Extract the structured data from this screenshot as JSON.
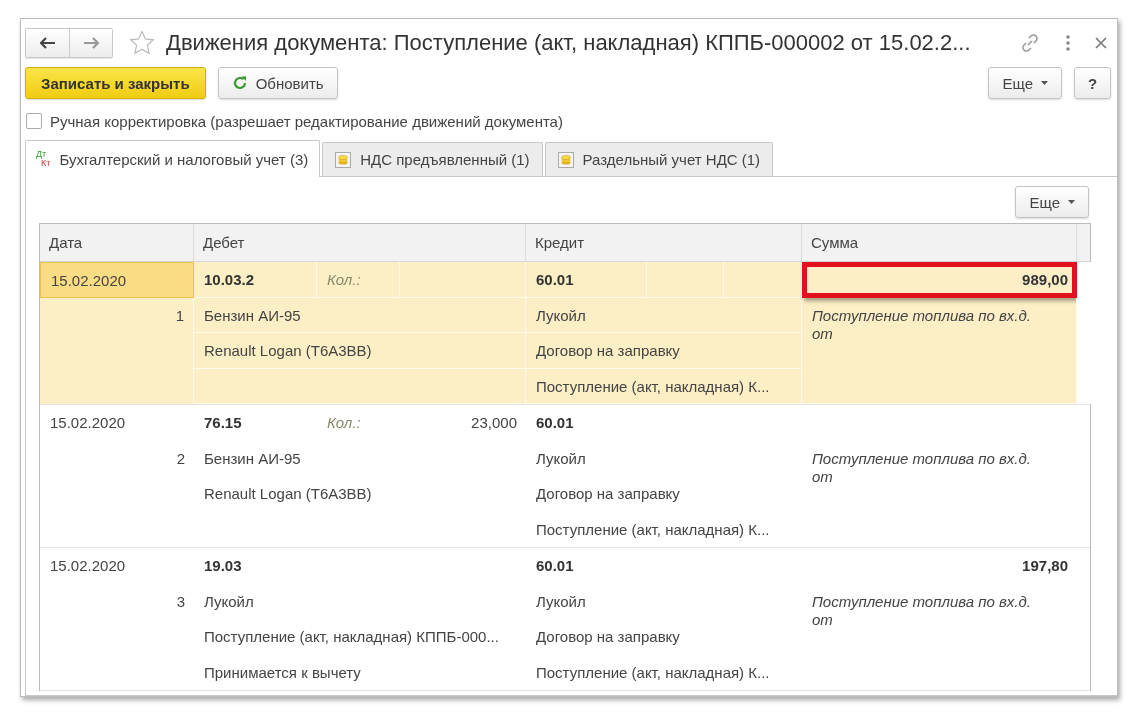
{
  "window": {
    "title": "Движения документа: Поступление (акт, накладная) КППБ-000002 от 15.02.2...",
    "favorite": false
  },
  "toolbar": [
    {
      "kind": "primary",
      "label": "Записать и закрыть"
    },
    {
      "kind": "refresh",
      "label": "Обновить"
    },
    {
      "kind": "menu",
      "label": "Еще"
    },
    {
      "kind": "help",
      "label": "?"
    }
  ],
  "manual_edit": {
    "label": "Ручная корректировка (разрешает редактирование движений документа)",
    "checked": false
  },
  "tabs": [
    {
      "kind": "accounts",
      "icon_top": "Дт",
      "icon_bottom": "Кт",
      "label": "Бухгалтерский и налоговый учет (3)",
      "selected": true
    },
    {
      "kind": "register",
      "label": "НДС предъявленный (1)",
      "selected": false
    },
    {
      "kind": "register",
      "label": "Раздельный учет НДС (1)",
      "selected": false
    }
  ],
  "panel_menu": {
    "label": "Еще"
  },
  "table": {
    "columns": [
      "Дата",
      "Дебет",
      "Кредит",
      "Сумма"
    ],
    "rows": [
      {
        "selected": true,
        "marked": true,
        "date": "15.02.2020",
        "number": "1",
        "debit": {
          "account": "10.03.2",
          "qty_label": "Кол.:",
          "lines": [
            "Бензин АИ-95",
            "Renault Logan (T6A3BB)"
          ]
        },
        "credit": {
          "account": "60.01",
          "lines": [
            "Лукойл",
            "Договор на заправку",
            "Поступление (акт, накладная) К..."
          ]
        },
        "amount": "989,00",
        "content": "Поступление топлива по вх.д. от"
      },
      {
        "selected": false,
        "marked": false,
        "date": "15.02.2020",
        "number": "2",
        "debit": {
          "account": "76.15",
          "qty_label": "Кол.:",
          "qty": "23,000",
          "lines": [
            "Бензин АИ-95",
            "Renault Logan (T6A3BB)"
          ]
        },
        "credit": {
          "account": "60.01",
          "lines": [
            "Лукойл",
            "Договор на заправку",
            "Поступление (акт, накладная) К..."
          ]
        },
        "content": "Поступление топлива по вх.д. от"
      },
      {
        "selected": false,
        "marked": false,
        "date": "15.02.2020",
        "number": "3",
        "debit": {
          "account": "19.03",
          "lines": [
            "Лукойл",
            "Поступление (акт, накладная) КППБ-000...",
            "Принимается к вычету"
          ]
        },
        "credit": {
          "account": "60.01",
          "lines": [
            "Лукойл",
            "Договор на заправку",
            "Поступление (акт, накладная) К..."
          ]
        },
        "amount": "197,80",
        "content": "Поступление топлива по вх.д. от"
      }
    ]
  }
}
